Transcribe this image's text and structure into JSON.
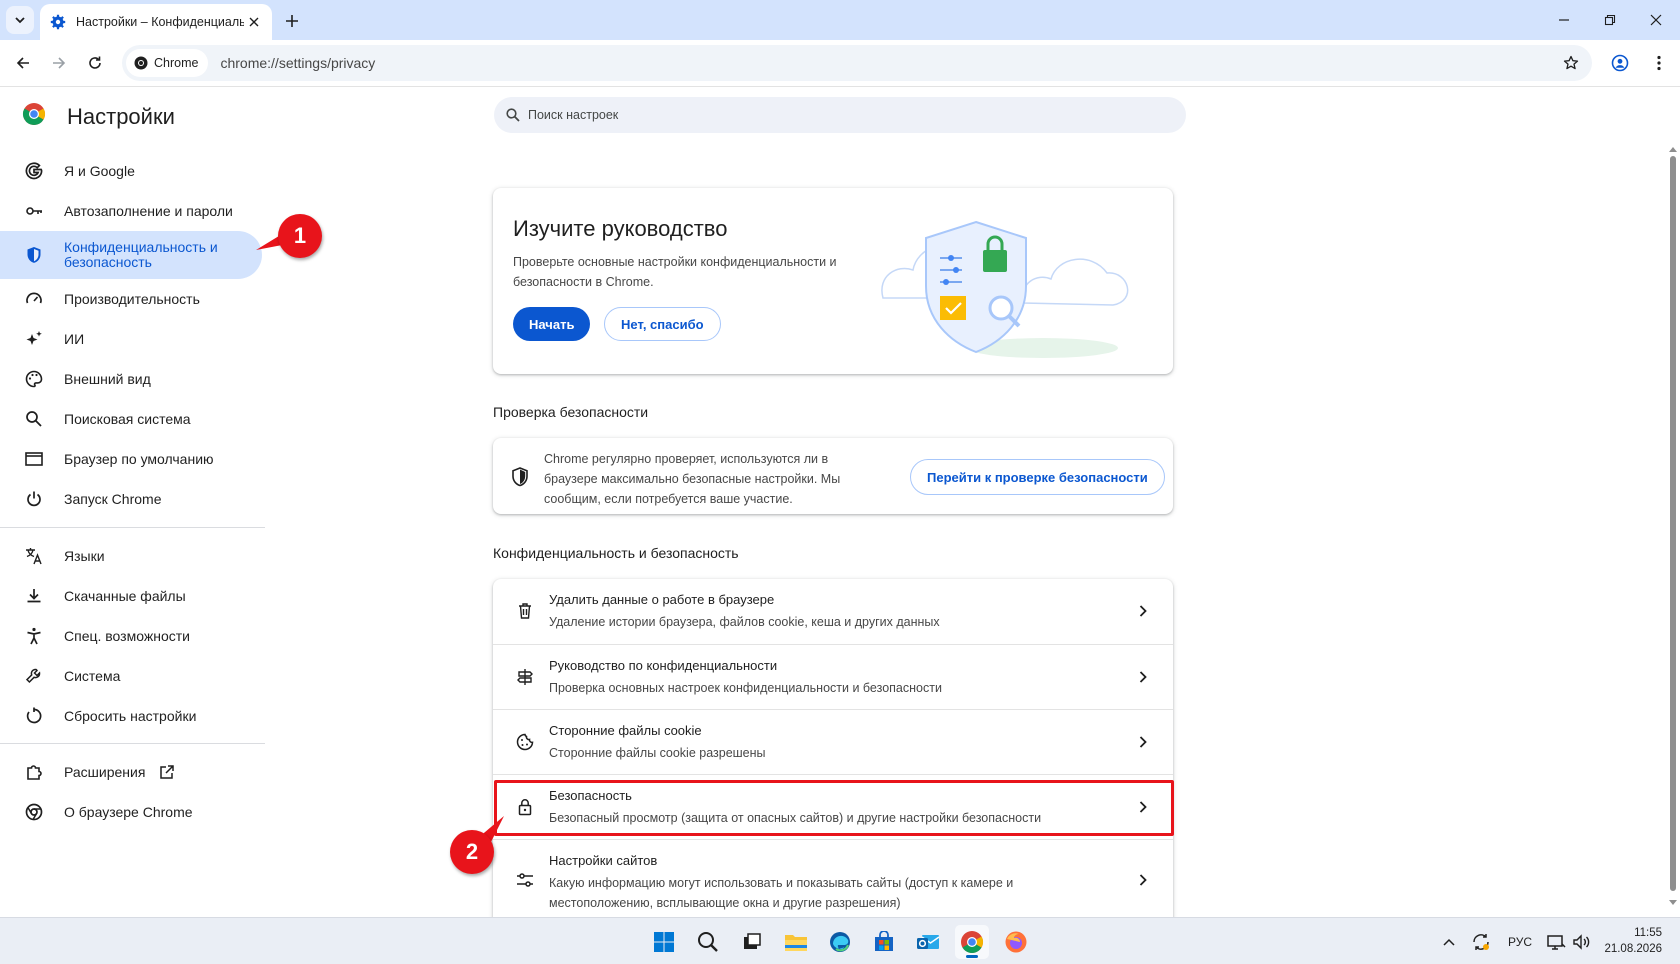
{
  "browser": {
    "tab_title": "Настройки – Конфиденциальн",
    "chip_label": "Chrome",
    "url": "chrome://settings/privacy"
  },
  "settings": {
    "title": "Настройки",
    "search_placeholder": "Поиск настроек"
  },
  "sidebar": {
    "items": [
      {
        "label": "Я и Google",
        "icon": "google-icon"
      },
      {
        "label": "Автозаполнение и пароли",
        "icon": "key-icon"
      },
      {
        "label": "Конфиденциальность и безопасность",
        "icon": "shield-icon",
        "active": true
      },
      {
        "label": "Производительность",
        "icon": "speedometer-icon"
      },
      {
        "label": "ИИ",
        "icon": "sparkle-icon"
      },
      {
        "label": "Внешний вид",
        "icon": "palette-icon"
      },
      {
        "label": "Поисковая система",
        "icon": "search-icon"
      },
      {
        "label": "Браузер по умолчанию",
        "icon": "browser-window-icon"
      },
      {
        "label": "Запуск Chrome",
        "icon": "power-icon"
      },
      {
        "label": "Языки",
        "icon": "translate-icon"
      },
      {
        "label": "Скачанные файлы",
        "icon": "download-icon"
      },
      {
        "label": "Спец. возможности",
        "icon": "accessibility-icon"
      },
      {
        "label": "Система",
        "icon": "wrench-icon"
      },
      {
        "label": "Сбросить настройки",
        "icon": "reset-icon"
      },
      {
        "label": "Расширения",
        "icon": "puzzle-icon"
      },
      {
        "label": "О браузере Chrome",
        "icon": "chrome-icon"
      }
    ]
  },
  "guide": {
    "title": "Изучите руководство",
    "description": "Проверьте основные настройки конфиденциальности и безопасности в Chrome.",
    "start_label": "Начать",
    "no_thanks_label": "Нет, спасибо"
  },
  "safety_check": {
    "section_title": "Проверка безопасности",
    "text": "Chrome регулярно проверяет, используются ли в браузере максимально безопасные настройки. Мы сообщим, если потребуется ваше участие.",
    "button_label": "Перейти к проверке безопасности"
  },
  "privacy": {
    "section_title": "Конфиденциальность и безопасность",
    "rows": [
      {
        "title": "Удалить данные о работе в браузере",
        "subtitle": "Удаление истории браузера, файлов cookie, кеша и других данных",
        "icon": "trash-icon"
      },
      {
        "title": "Руководство по конфиденциальности",
        "subtitle": "Проверка основных настроек конфиденциальности и безопасности",
        "icon": "signpost-icon"
      },
      {
        "title": "Сторонние файлы cookie",
        "subtitle": "Сторонние файлы cookie разрешены",
        "icon": "cookie-icon"
      },
      {
        "title": "Безопасность",
        "subtitle": "Безопасный просмотр (защита от опасных сайтов) и другие настройки безопасности",
        "icon": "lock-icon"
      },
      {
        "title": "Настройки сайтов",
        "subtitle": "Какую информацию могут использовать и показывать сайты (доступ к камере и местоположению, всплывающие окна и другие разрешения)",
        "icon": "sliders-icon"
      }
    ]
  },
  "annotations": {
    "callout_1": "1",
    "callout_2": "2"
  },
  "taskbar": {
    "language": "РУС",
    "time": "11:55",
    "date": "21.08.2026"
  },
  "colors": {
    "accent": "#0b57d0",
    "nav_active_bg": "#d3e3fd",
    "annotation_red": "#e8141b"
  }
}
